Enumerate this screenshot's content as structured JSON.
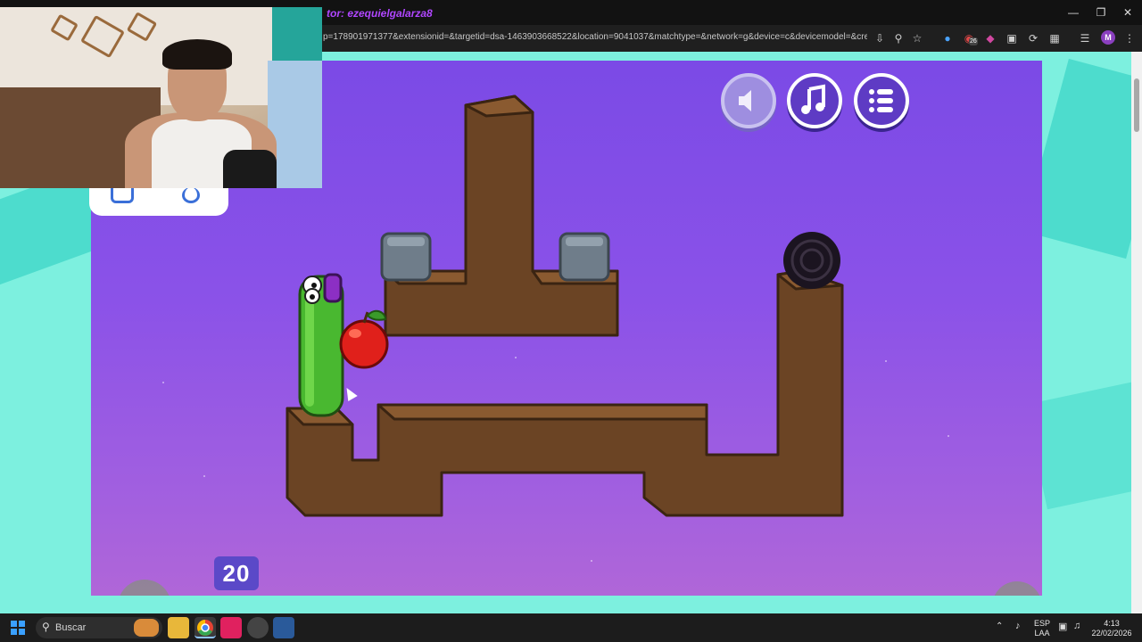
{
  "browser": {
    "title_text": "tor: ezequielgalarza8",
    "url": "p=178901971377&extensionid=&targetid=dsa-1463903668522&location=9041037&matchtype=&network=g&device=c&devicemodel=&creativ...",
    "profile_initial": "M",
    "extension_badge": "26"
  },
  "game": {
    "moves_remaining": "20",
    "buttons": [
      "sound-off",
      "music",
      "menu"
    ],
    "colors": {
      "sky_top": "#7b4ae6",
      "dirt": "#6b4424",
      "worm": "#49b830",
      "apple": "#e0201b"
    }
  },
  "taskbar": {
    "search_label": "Buscar",
    "lang_top": "ESP",
    "lang_bottom": "LAA",
    "time": "4:13",
    "date": "22/02/2026"
  }
}
